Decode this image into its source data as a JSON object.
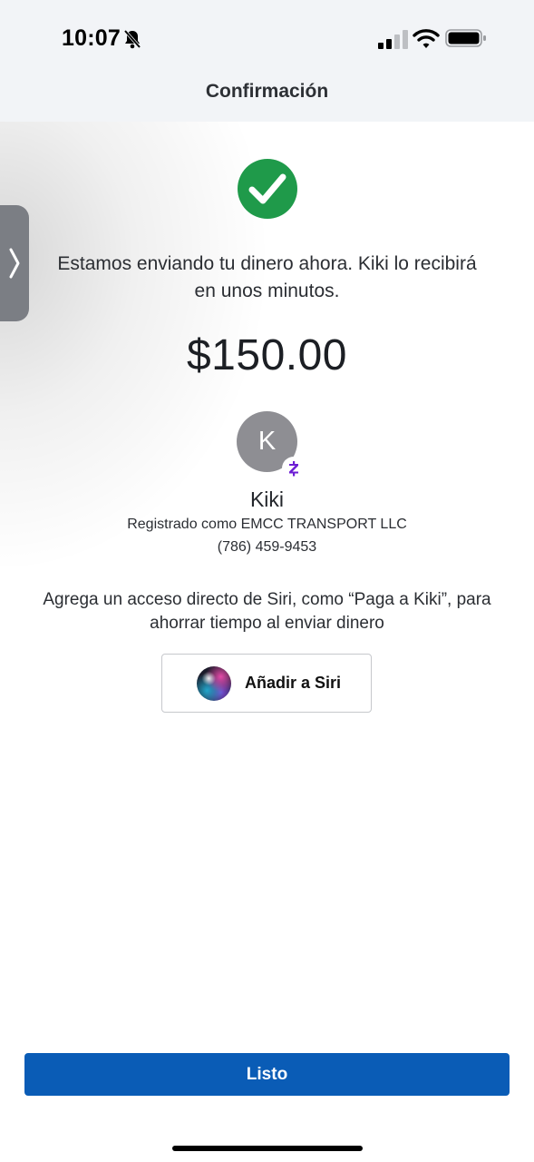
{
  "status_bar": {
    "time": "10:07",
    "icons": [
      "bell-slash-icon",
      "signal-icon",
      "wifi-icon",
      "battery-icon"
    ]
  },
  "header": {
    "title": "Confirmación"
  },
  "side_handle": {
    "icon": "chevron-right-icon"
  },
  "confirmation": {
    "icon": "check-circle-icon",
    "message": "Estamos enviando tu dinero ahora. Kiki lo recibirá en unos minutos.",
    "amount": "$150.00"
  },
  "recipient": {
    "initial": "K",
    "name": "Kiki",
    "registered_as": "Registrado como EMCC TRANSPORT LLC",
    "phone": "(786) 459-9453",
    "badge_icon": "zelle-icon"
  },
  "siri": {
    "message": "Agrega un acceso directo de Siri, como “Paga a Kiki”, para ahorrar tiempo al enviar dinero",
    "button_label": "Añadir a Siri",
    "button_icon": "siri-icon"
  },
  "footer": {
    "done_label": "Listo"
  },
  "colors": {
    "header_bg": "#f2f4f7",
    "success_green": "#1f9a4a",
    "primary_blue": "#0a5cb6",
    "zelle_purple": "#6d1ed4",
    "avatar_gray": "#8e8e93"
  }
}
